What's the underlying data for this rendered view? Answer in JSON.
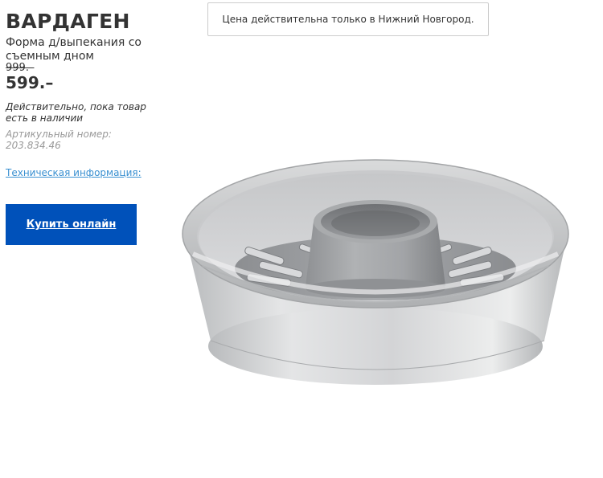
{
  "product": {
    "name": "ВАРДАГЕН",
    "description": "Форма д/выпекания со съемным дном",
    "old_price": "999.–",
    "new_price": "599.–",
    "availability": "Действительно, пока товар есть в наличии",
    "article": "Артикульный номер: 203.834.46",
    "tech_info_link": "Техническая информация:",
    "buy_button": "Купить онлайн",
    "image_alt": "cake-pan-image"
  },
  "notice": {
    "text": "Цена действительна только в Нижний Новгород."
  },
  "colors": {
    "buy_button_bg": "#0051ba",
    "link": "#3a90d1",
    "muted_text": "#999999"
  }
}
